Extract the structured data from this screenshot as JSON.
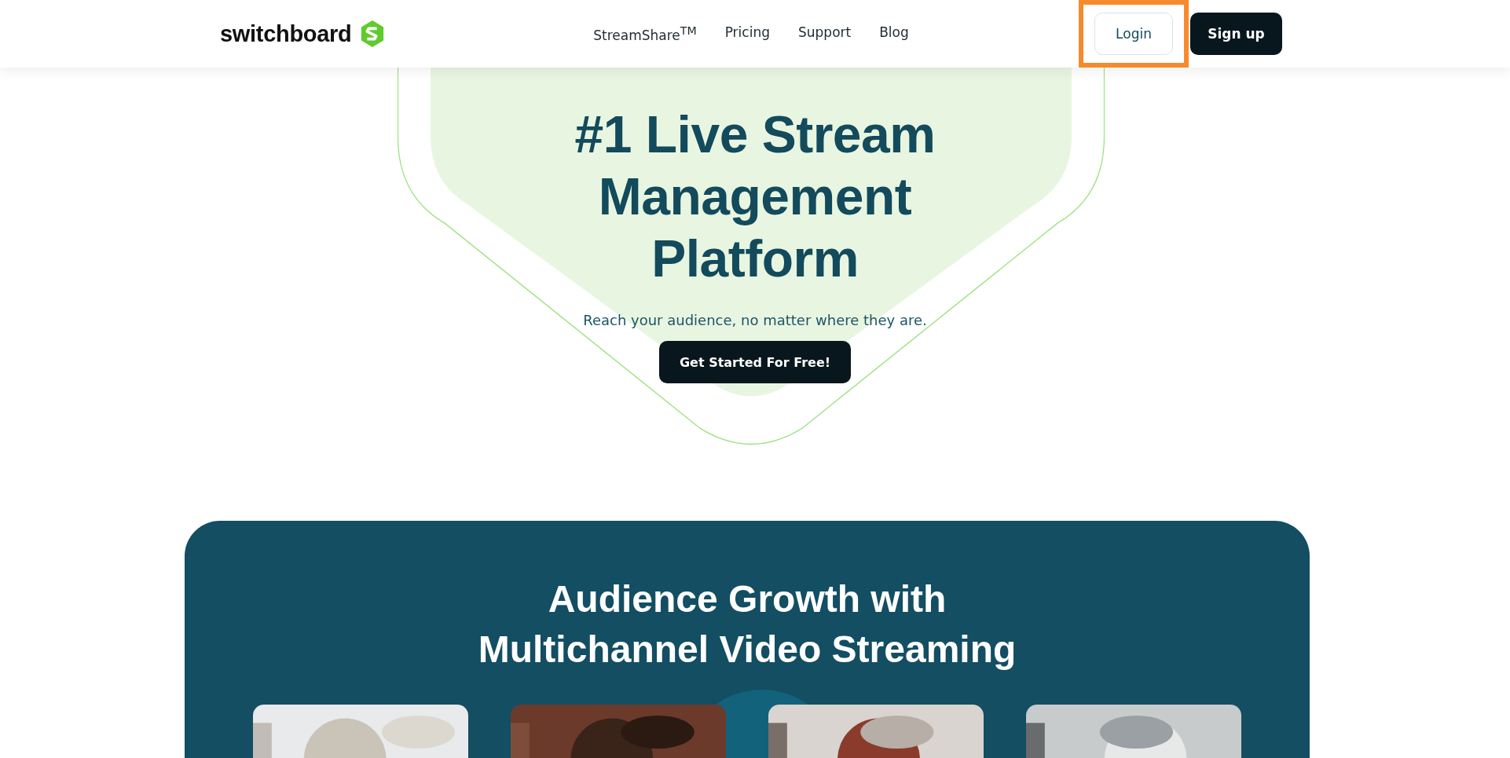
{
  "header": {
    "logo": "switchboard",
    "nav": [
      {
        "label": "StreamShare$^{TM}$"
      },
      {
        "label": "Pricing"
      },
      {
        "label": "Support"
      },
      {
        "label": "Blog"
      }
    ],
    "login": {
      "label": "Login",
      "highlighted": true
    },
    "signup": {
      "label": "Sign up"
    }
  },
  "hero": {
    "title_lines": [
      "#1 Live Stream",
      "Management",
      "Platform"
    ],
    "subtitle": "Reach your audience, no matter where they are.",
    "cta": "Get Started For Free!"
  },
  "growth": {
    "heading_lines": [
      "Audience Growth with",
      "Multichannel Video Streaming"
    ],
    "cards": [
      {
        "kind": "picture"
      },
      {
        "kind": "picture"
      },
      {
        "kind": "picture"
      },
      {
        "kind": "picture"
      }
    ]
  }
}
